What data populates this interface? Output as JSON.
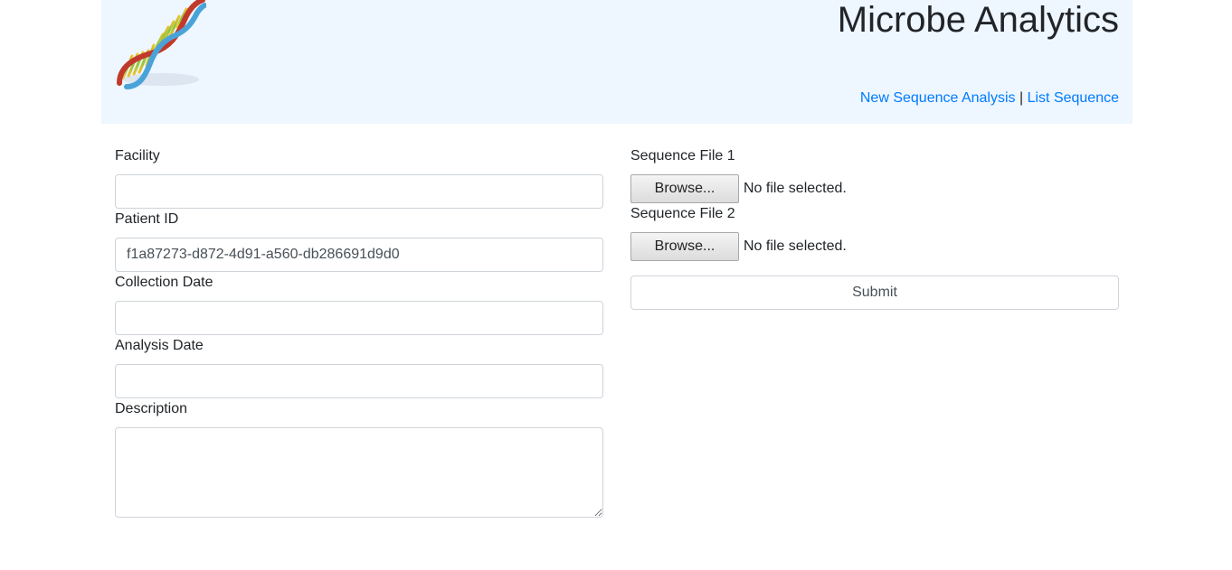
{
  "header": {
    "title": "Microbe Analytics",
    "logo_icon": "dna-helix-icon",
    "nav": {
      "new_analysis": "New Sequence Analysis",
      "separator": "|",
      "list": "List Sequence"
    }
  },
  "form": {
    "facility": {
      "label": "Facility",
      "value": "",
      "placeholder": ""
    },
    "patient_id": {
      "label": "Patient ID",
      "value": "f1a87273-d872-4d91-a560-db286691d9d0"
    },
    "collection_date": {
      "label": "Collection Date",
      "value": ""
    },
    "analysis_date": {
      "label": "Analysis Date",
      "value": ""
    },
    "description": {
      "label": "Description",
      "value": ""
    },
    "file1": {
      "label": "Sequence File 1",
      "button": "Browse...",
      "status": "No file selected."
    },
    "file2": {
      "label": "Sequence File 2",
      "button": "Browse...",
      "status": "No file selected."
    },
    "submit_label": "Submit"
  },
  "colors": {
    "header_bg": "#eef6ff",
    "link": "#007bff",
    "border": "#ced4da"
  }
}
